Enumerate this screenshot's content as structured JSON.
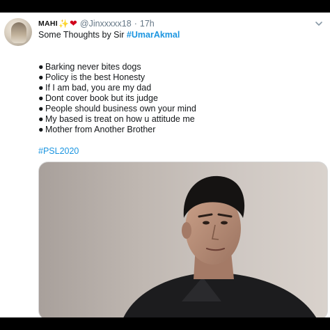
{
  "tweet": {
    "display_name": "MAHI",
    "sparkle_icon": "sparkles-icon",
    "heart_icon": "heart-icon",
    "handle": "@Jinxxxxx18",
    "separator": "·",
    "time": "17h",
    "intro_prefix": "Some Thoughts by Sir ",
    "intro_hashtag": "#UmarAkmal",
    "bullet_char": "●",
    "bullets": [
      "Barking never bites dogs",
      "Policy is the best Honesty",
      "If I am bad, you are my dad",
      "Dont cover book but its judge",
      "People should business own your mind",
      "My based is treat on how u attitude me",
      "Mother from Another Brother"
    ],
    "footer_hashtag": "#PSL2020",
    "menu_icon": "chevron-down-icon"
  },
  "colors": {
    "link": "#1b95e0",
    "muted": "#657786",
    "text": "#14171a",
    "background": "#ffffff"
  }
}
